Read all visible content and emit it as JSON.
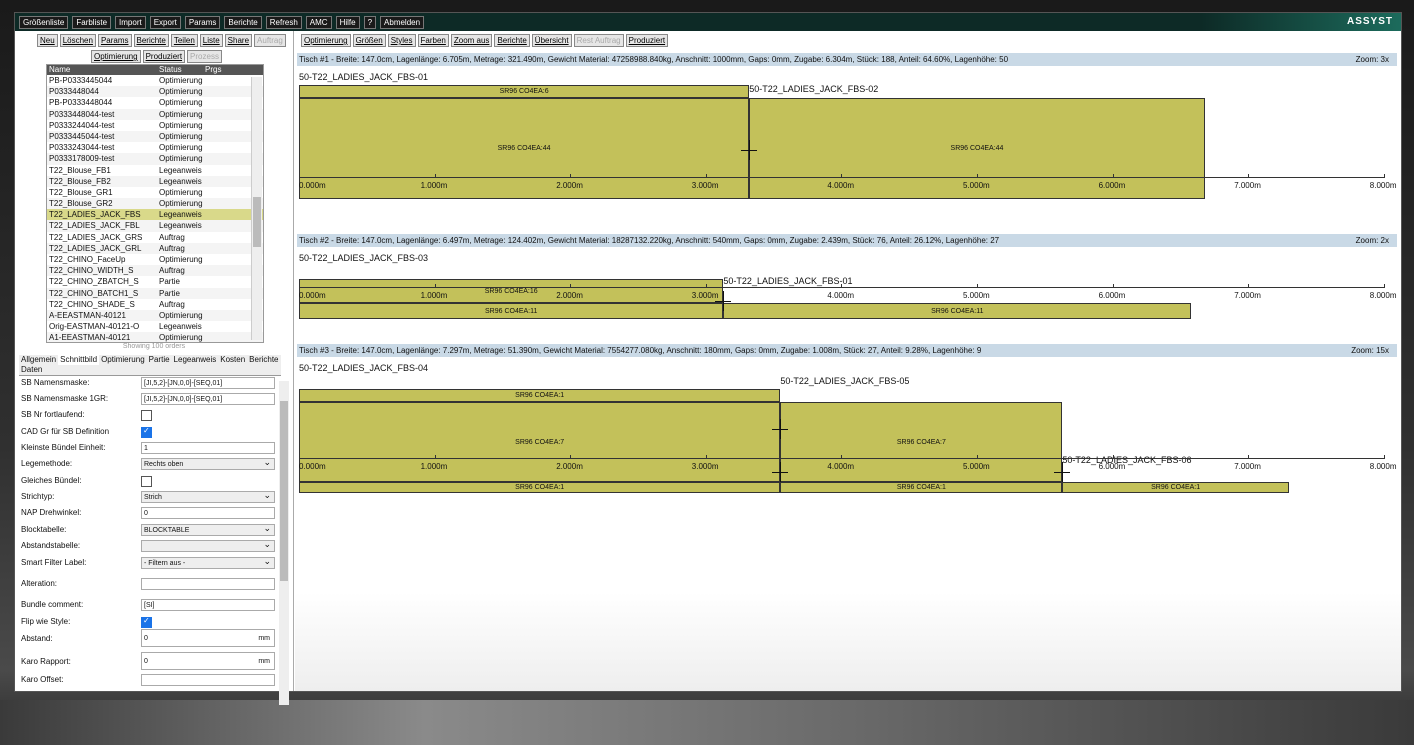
{
  "brand": "ASSYST",
  "menu": [
    "Größenliste",
    "Farbliste",
    "Import",
    "Export",
    "Params",
    "Berichte",
    "Refresh",
    "AMC",
    "Hilfe",
    "?",
    "Abmelden"
  ],
  "order_buttons": [
    "Neu",
    "Löschen",
    "Params",
    "Berichte",
    "Teilen",
    "Liste",
    "Share",
    "Auftrag"
  ],
  "order_buttons2": [
    "Optimierung",
    "Produziert",
    "Prozess"
  ],
  "orders": {
    "columns": [
      "Name",
      "Status",
      "Prgs Sharing"
    ],
    "rows": [
      [
        "PB-P0333445044",
        "Optimierung"
      ],
      [
        "P0333448044",
        "Optimierung"
      ],
      [
        "PB-P0333448044",
        "Optimierung"
      ],
      [
        "P0333448044-test",
        "Optimierung"
      ],
      [
        "P0333244044-test",
        "Optimierung"
      ],
      [
        "P0333445044-test",
        "Optimierung"
      ],
      [
        "P0333243044-test",
        "Optimierung"
      ],
      [
        "P0333178009-test",
        "Optimierung"
      ],
      [
        "T22_Blouse_FB1",
        "Legeanweis"
      ],
      [
        "T22_Blouse_FB2",
        "Legeanweis"
      ],
      [
        "T22_Blouse_GR1",
        "Optimierung"
      ],
      [
        "T22_Blouse_GR2",
        "Optimierung"
      ],
      [
        "T22_LADIES_JACK_FBS",
        "Legeanweis"
      ],
      [
        "T22_LADIES_JACK_FBL",
        "Legeanweis"
      ],
      [
        "T22_LADIES_JACK_GRS",
        "Auftrag"
      ],
      [
        "T22_LADIES_JACK_GRL",
        "Auftrag"
      ],
      [
        "T22_CHINO_FaceUp",
        "Optimierung"
      ],
      [
        "T22_CHINO_WIDTH_S",
        "Auftrag"
      ],
      [
        "T22_CHINO_ZBATCH_S",
        "Partie"
      ],
      [
        "T22_CHINO_BATCH1_S",
        "Partie"
      ],
      [
        "T22_CHINO_SHADE_S",
        "Auftrag"
      ],
      [
        "A-EEASTMAN-40121",
        "Optimierung"
      ],
      [
        "Orig-EASTMAN-40121-O",
        "Legeanweis"
      ],
      [
        "A1-EEASTMAN-40121",
        "Optimierung"
      ]
    ],
    "selected": 12,
    "showing": "Showing 100 orders"
  },
  "tabs": [
    "Allgemein",
    "Schnittbild",
    "Optimierung",
    "Partie",
    "Legeanweis",
    "Kosten",
    "Berichte",
    "Daten"
  ],
  "props": [
    {
      "label": "SB Namensmaske:",
      "type": "text",
      "value": "[JI,5,2]-[JN,0,0]-[SEQ,01]"
    },
    {
      "label": "SB Namensmaske 1GR:",
      "type": "text",
      "value": "[JI,5,2]-[JN,0,0]-[SEQ,01]"
    },
    {
      "label": "SB Nr fortlaufend:",
      "type": "check",
      "value": ""
    },
    {
      "label": "CAD Gr für SB Definition",
      "type": "checkon",
      "value": ""
    },
    {
      "label": "Kleinste Bündel Einheit:",
      "type": "text",
      "value": "1"
    },
    {
      "label": "Legemethode:",
      "type": "select",
      "value": "Rechts oben"
    },
    {
      "label": "Gleiches Bündel:",
      "type": "check",
      "value": ""
    },
    {
      "label": "Strichtyp:",
      "type": "select",
      "value": "Strich"
    },
    {
      "label": "NAP Drehwinkel:",
      "type": "text",
      "value": "0"
    },
    {
      "label": "Blocktabelle:",
      "type": "select",
      "value": "BLOCKTABLE"
    },
    {
      "label": "Abstandstabelle:",
      "type": "select",
      "value": ""
    },
    {
      "label": "Smart Filter Label:",
      "type": "select",
      "value": "- Filtern aus -"
    },
    {
      "label": "Alteration:",
      "type": "text",
      "value": ""
    },
    {
      "label": "Bundle comment:",
      "type": "text",
      "value": "[SI]"
    },
    {
      "label": "Flip wie Style:",
      "type": "checkon",
      "value": ""
    },
    {
      "label": "Abstand:",
      "type": "unit",
      "value": "0",
      "unit": "mm"
    },
    {
      "label": "Karo Rapport:",
      "type": "unit",
      "value": "0",
      "unit": "mm"
    },
    {
      "label": "Karo Offset:",
      "type": "text",
      "value": ""
    }
  ],
  "toolbar": [
    "Optimierung",
    "Größen",
    "Styles",
    "Farben",
    "Zoom aus",
    "Berichte",
    "Übersicht",
    "Rest Auftrag",
    "Produziert"
  ],
  "toolbar_disabled": [
    7
  ],
  "axis_labels": [
    "0.000m",
    "1.000m",
    "2.000m",
    "3.000m",
    "4.000m",
    "5.000m",
    "6.000m",
    "7.000m",
    "8.000m"
  ],
  "tische": [
    {
      "header": "Tisch #1 - Breite: 147.0cm, Lagenlänge: 6.705m, Metrage: 321.490m, Gewicht Material: 47258988.840kg, Anschnitt: 1000mm, Gaps: 0mm, Zugabe: 6.304m, Stück: 188, Anteil: 64.60%, Lagenhöhe: 50",
      "zoom": "Zoom: 3x",
      "markers": [
        "50-T22_LADIES_JACK_FBS-01",
        "50-T22_LADIES_JACK_FBS-02"
      ],
      "blocks": [
        "SR96 CO4EA:6",
        "SR96 CO4EA:44",
        "SR96 CO4EA:44"
      ]
    },
    {
      "header": "Tisch #2 - Breite: 147.0cm, Lagenlänge: 6.497m, Metrage: 124.402m, Gewicht Material: 18287132.220kg, Anschnitt: 540mm, Gaps: 0mm, Zugabe: 2.439m, Stück: 76, Anteil: 26.12%, Lagenhöhe: 27",
      "zoom": "Zoom: 2x",
      "markers": [
        "50-T22_LADIES_JACK_FBS-03",
        "50-T22_LADIES_JACK_FBS-01"
      ],
      "blocks": [
        "SR96 CO4EA:16",
        "SR96 CO4EA:11",
        "SR96 CO4EA:11"
      ]
    },
    {
      "header": "Tisch #3 - Breite: 147.0cm, Lagenlänge: 7.297m, Metrage: 51.390m, Gewicht Material: 7554277.080kg, Anschnitt: 180mm, Gaps: 0mm, Zugabe: 1.008m, Stück: 27, Anteil: 9.28%, Lagenhöhe: 9",
      "zoom": "Zoom: 15x",
      "markers": [
        "50-T22_LADIES_JACK_FBS-04",
        "50-T22_LADIES_JACK_FBS-05",
        "50-T22_LADIES_JACK_FBS-06"
      ],
      "blocks": [
        "SR96 CO4EA:1",
        "SR96 CO4EA:7",
        "SR96 CO4EA:1",
        "SR96 CO4EA:7",
        "SR96 CO4EA:1",
        "SR96 CO4EA:1"
      ]
    }
  ]
}
